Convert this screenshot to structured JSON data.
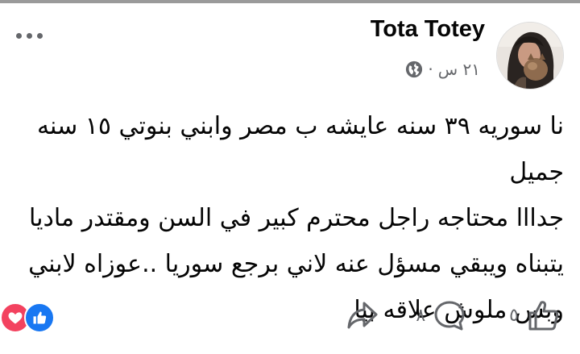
{
  "post": {
    "author": "Tota Totey",
    "time": "٢١ س",
    "separator": "·",
    "privacy_icon": "globe-icon",
    "text_lines": [
      "نا سوريه ٣٩ سنه عايشه ب مصر وابني بنوتي ١٥ سنه جميل",
      "جدااا محتاجه راجل محترم كبير في السن ومقتدر ماديا",
      "يتبناه ويبقي مسؤل عنه لاني برجع سوريا ..عوزاه لابني",
      "وبس ملوش علاقه بيا"
    ]
  },
  "reactions": {
    "icons": [
      "love-icon",
      "like-icon"
    ]
  },
  "actions": {
    "like_count": "٥",
    "comment_count": "٨",
    "like_icon": "thumbs-up-icon",
    "comment_icon": "comment-icon",
    "share_icon": "share-icon"
  },
  "colors": {
    "text": "#050505",
    "secondary": "#65676b",
    "like_blue": "#1877f2",
    "love_red": "#f3425f"
  }
}
